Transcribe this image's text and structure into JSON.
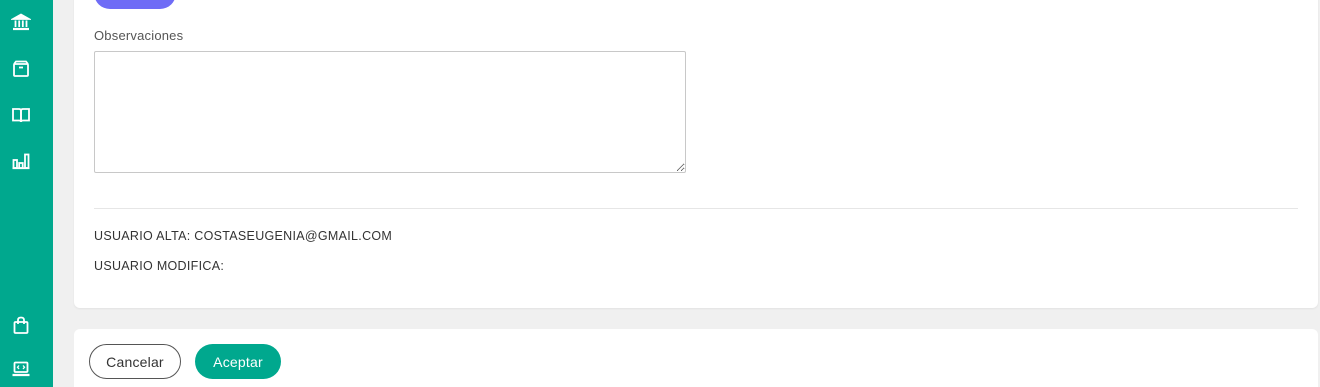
{
  "sidebar": {
    "color": "#00a88e",
    "items": [
      {
        "icon": "bank-icon"
      },
      {
        "icon": "package-icon"
      },
      {
        "icon": "book-open-icon"
      },
      {
        "icon": "bar-chart-icon"
      },
      {
        "icon": "shopping-bag-icon"
      },
      {
        "icon": "laptop-code-icon"
      }
    ]
  },
  "form": {
    "observaciones_label": "Observaciones",
    "observaciones_value": "",
    "usuario_alta": "USUARIO ALTA: COSTASEUGENIA@GMAIL.COM",
    "usuario_modifica": "USUARIO MODIFICA:"
  },
  "actions": {
    "cancel_label": "Cancelar",
    "accept_label": "Aceptar",
    "accent_color": "#00a88e",
    "purple_color": "#6f6cf6"
  }
}
